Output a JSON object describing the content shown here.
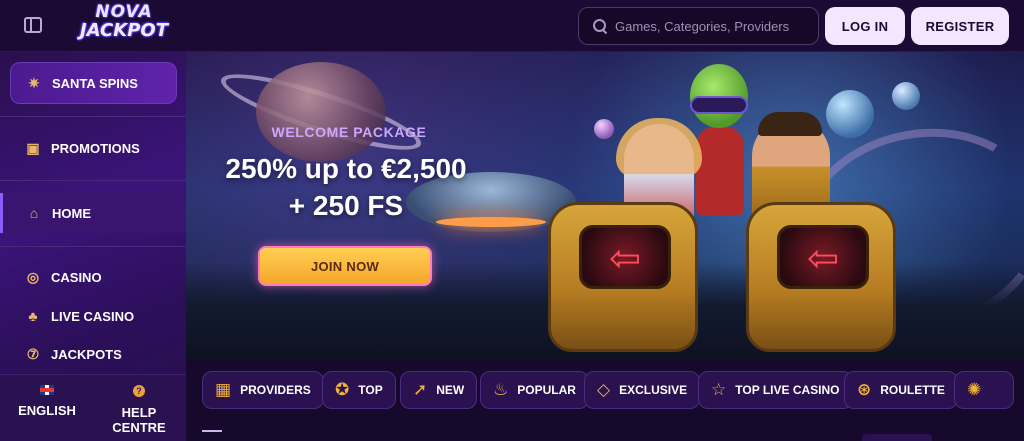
{
  "header": {
    "logo_line1": "NOVA",
    "logo_line2": "JACKPOT",
    "search_placeholder": "Games, Categories, Providers",
    "login_label": "LOG IN",
    "register_label": "REGISTER",
    "accent_color": "#f3e6ff"
  },
  "sidebar": {
    "items": [
      {
        "label": "SANTA SPINS",
        "icon": "star-icon"
      },
      {
        "label": "PROMOTIONS",
        "icon": "gift-icon"
      },
      {
        "label": "HOME",
        "icon": "home-icon",
        "active": true
      },
      {
        "label": "CASINO",
        "icon": "chip-icon"
      },
      {
        "label": "LIVE CASINO",
        "icon": "club-icon"
      },
      {
        "label": "JACKPOTS",
        "icon": "seven-icon"
      }
    ],
    "language_label": "ENGLISH",
    "help_label": "HELP CENTRE"
  },
  "hero": {
    "eyebrow": "WELCOME PACKAGE",
    "line1": "250% up to €2,500",
    "line2": "+ 250 FS",
    "cta_label": "JOIN NOW"
  },
  "categories": [
    {
      "label": "PROVIDERS",
      "icon": "grid-icon"
    },
    {
      "label": "TOP",
      "icon": "medal-icon"
    },
    {
      "label": "NEW",
      "icon": "rocket-icon"
    },
    {
      "label": "POPULAR",
      "icon": "flame-icon"
    },
    {
      "label": "EXCLUSIVE",
      "icon": "diamond-icon"
    },
    {
      "label": "TOP LIVE CASINO",
      "icon": "star-icon"
    },
    {
      "label": "ROULETTE",
      "icon": "roulette-icon"
    },
    {
      "label": "",
      "icon": "wheel-icon"
    }
  ]
}
